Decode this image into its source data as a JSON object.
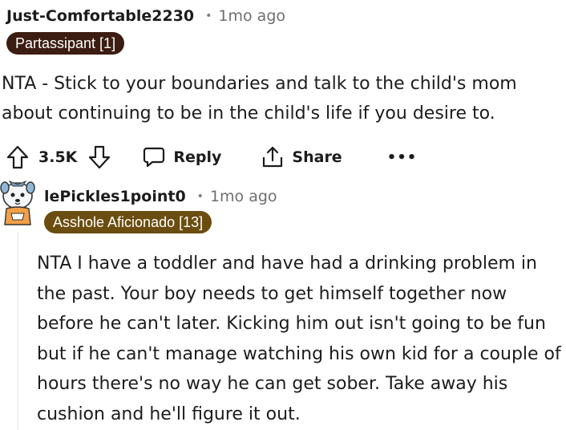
{
  "comment1": {
    "username": "Just-Comfortable2230",
    "separator": "•",
    "time": "1mo ago",
    "flair": "Partassipant [1]",
    "flair_color": "#3b1d12",
    "body": "NTA - Stick to your boundaries and talk to the child's mom about continuing to be in the child's life if you desire to.",
    "actions": {
      "upvote_icon": "arrow-up-icon",
      "vote_count": "3.5K",
      "downvote_icon": "arrow-down-icon",
      "reply_icon": "speech-bubble-icon",
      "reply_label": "Reply",
      "share_icon": "share-icon",
      "share_label": "Share",
      "more_label": "•••"
    }
  },
  "comment2": {
    "avatar": "snoo-avatar",
    "username": "lePickles1point0",
    "separator": "•",
    "time": "1mo ago",
    "flair": "Asshole Aficionado [13]",
    "flair_color": "#6b4d10",
    "body": "NTA I have a toddler and have had a drinking problem in the past. Your boy needs to get himself together now before he can't later. Kicking him out isn't going to be fun but if he can't manage watching his own kid for a couple of hours there's no way he can get sober. Take away his cushion and he'll figure it out."
  }
}
